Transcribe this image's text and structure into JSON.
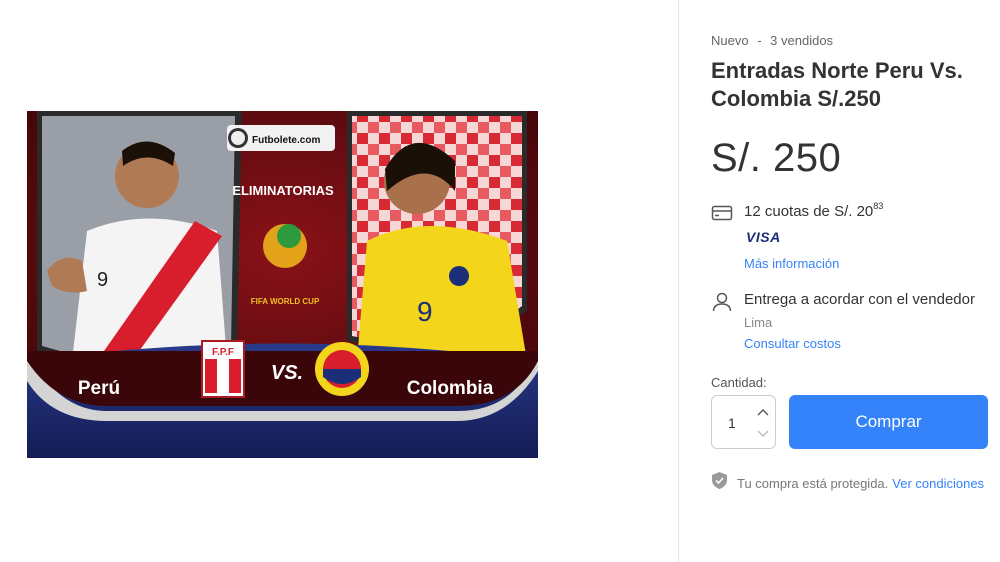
{
  "product": {
    "condition": "Nuevo",
    "separator": "-",
    "sold": "3 vendidos",
    "title": "Entradas Norte Peru Vs. Colombia S/.250",
    "price": "S/. 250"
  },
  "image": {
    "brand": "Futbolete.com",
    "event": "ELIMINATORIAS",
    "cup": "FIFA WORLD CUP",
    "team_left": "Perú",
    "team_right": "Colombia",
    "vs": "VS.",
    "fpf": "F.P.F",
    "jersey_left": "9",
    "jersey_right": "9"
  },
  "payment": {
    "installments": "12 cuotas de S/. 20",
    "cents": "83",
    "card": "VISA",
    "more_info": "Más información"
  },
  "shipping": {
    "text": "Entrega a acordar con el vendedor",
    "city": "Lima",
    "costs_link": "Consultar costos"
  },
  "purchase": {
    "quantity_label": "Cantidad:",
    "quantity_value": "1",
    "buy_label": "Comprar"
  },
  "protection": {
    "text": "Tu compra está protegida.",
    "link": "Ver condiciones"
  },
  "colors": {
    "accent": "#3483fa",
    "peru_red": "#d81e2c",
    "colombia_yellow": "#f3d51c"
  }
}
